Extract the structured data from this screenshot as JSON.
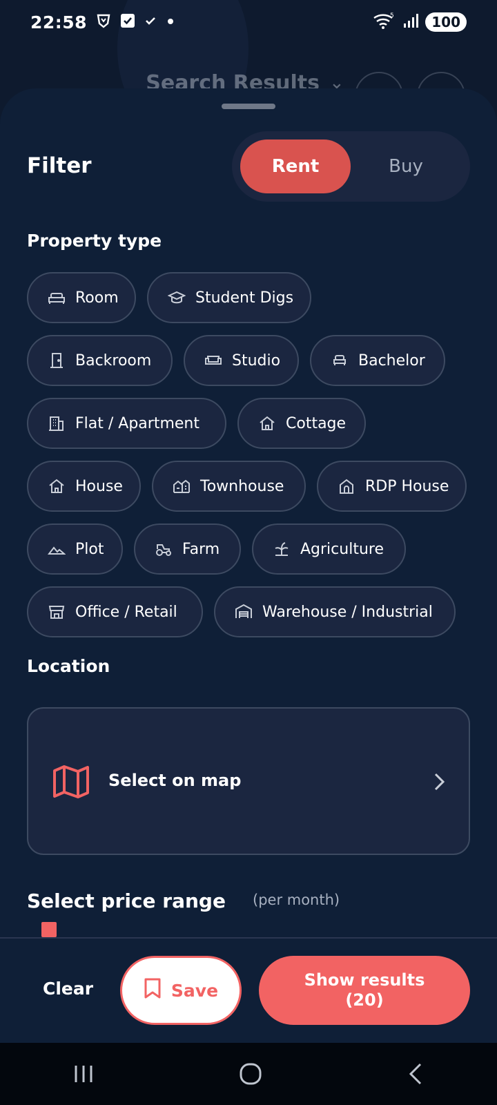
{
  "status_bar": {
    "time": "22:58",
    "battery": "100"
  },
  "background_header": {
    "title": "Search Results"
  },
  "filter": {
    "title": "Filter",
    "modes": [
      {
        "label": "Rent",
        "selected": true
      },
      {
        "label": "Buy",
        "selected": false
      }
    ]
  },
  "property_type": {
    "title": "Property type",
    "options": [
      {
        "label": "Room",
        "icon": "bed-icon"
      },
      {
        "label": "Student Digs",
        "icon": "graduation-cap-icon"
      },
      {
        "label": "Backroom",
        "icon": "door-icon"
      },
      {
        "label": "Studio",
        "icon": "sofa-icon"
      },
      {
        "label": "Bachelor",
        "icon": "single-bed-icon"
      },
      {
        "label": "Flat / Apartment",
        "icon": "building-icon"
      },
      {
        "label": "Cottage",
        "icon": "cottage-icon"
      },
      {
        "label": "House",
        "icon": "house-icon"
      },
      {
        "label": "Townhouse",
        "icon": "townhouse-icon"
      },
      {
        "label": "RDP House",
        "icon": "rdp-house-icon"
      },
      {
        "label": "Plot",
        "icon": "landscape-icon"
      },
      {
        "label": "Farm",
        "icon": "tractor-icon"
      },
      {
        "label": "Agriculture",
        "icon": "plant-icon"
      },
      {
        "label": "Office / Retail",
        "icon": "store-icon"
      },
      {
        "label": "Warehouse / Industrial",
        "icon": "warehouse-icon"
      }
    ]
  },
  "location": {
    "title": "Location",
    "select_label": "Select on map"
  },
  "price_range": {
    "title": "Select price range",
    "unit": "(per month)"
  },
  "actions": {
    "clear": "Clear",
    "save": "Save",
    "show_results_line1": "Show results",
    "show_results_line2": "(20)"
  },
  "colors": {
    "accent": "#f26363",
    "selected_toggle": "#d9534f",
    "sheet_background": "#0f1f37",
    "chip_background": "#1b2640"
  }
}
